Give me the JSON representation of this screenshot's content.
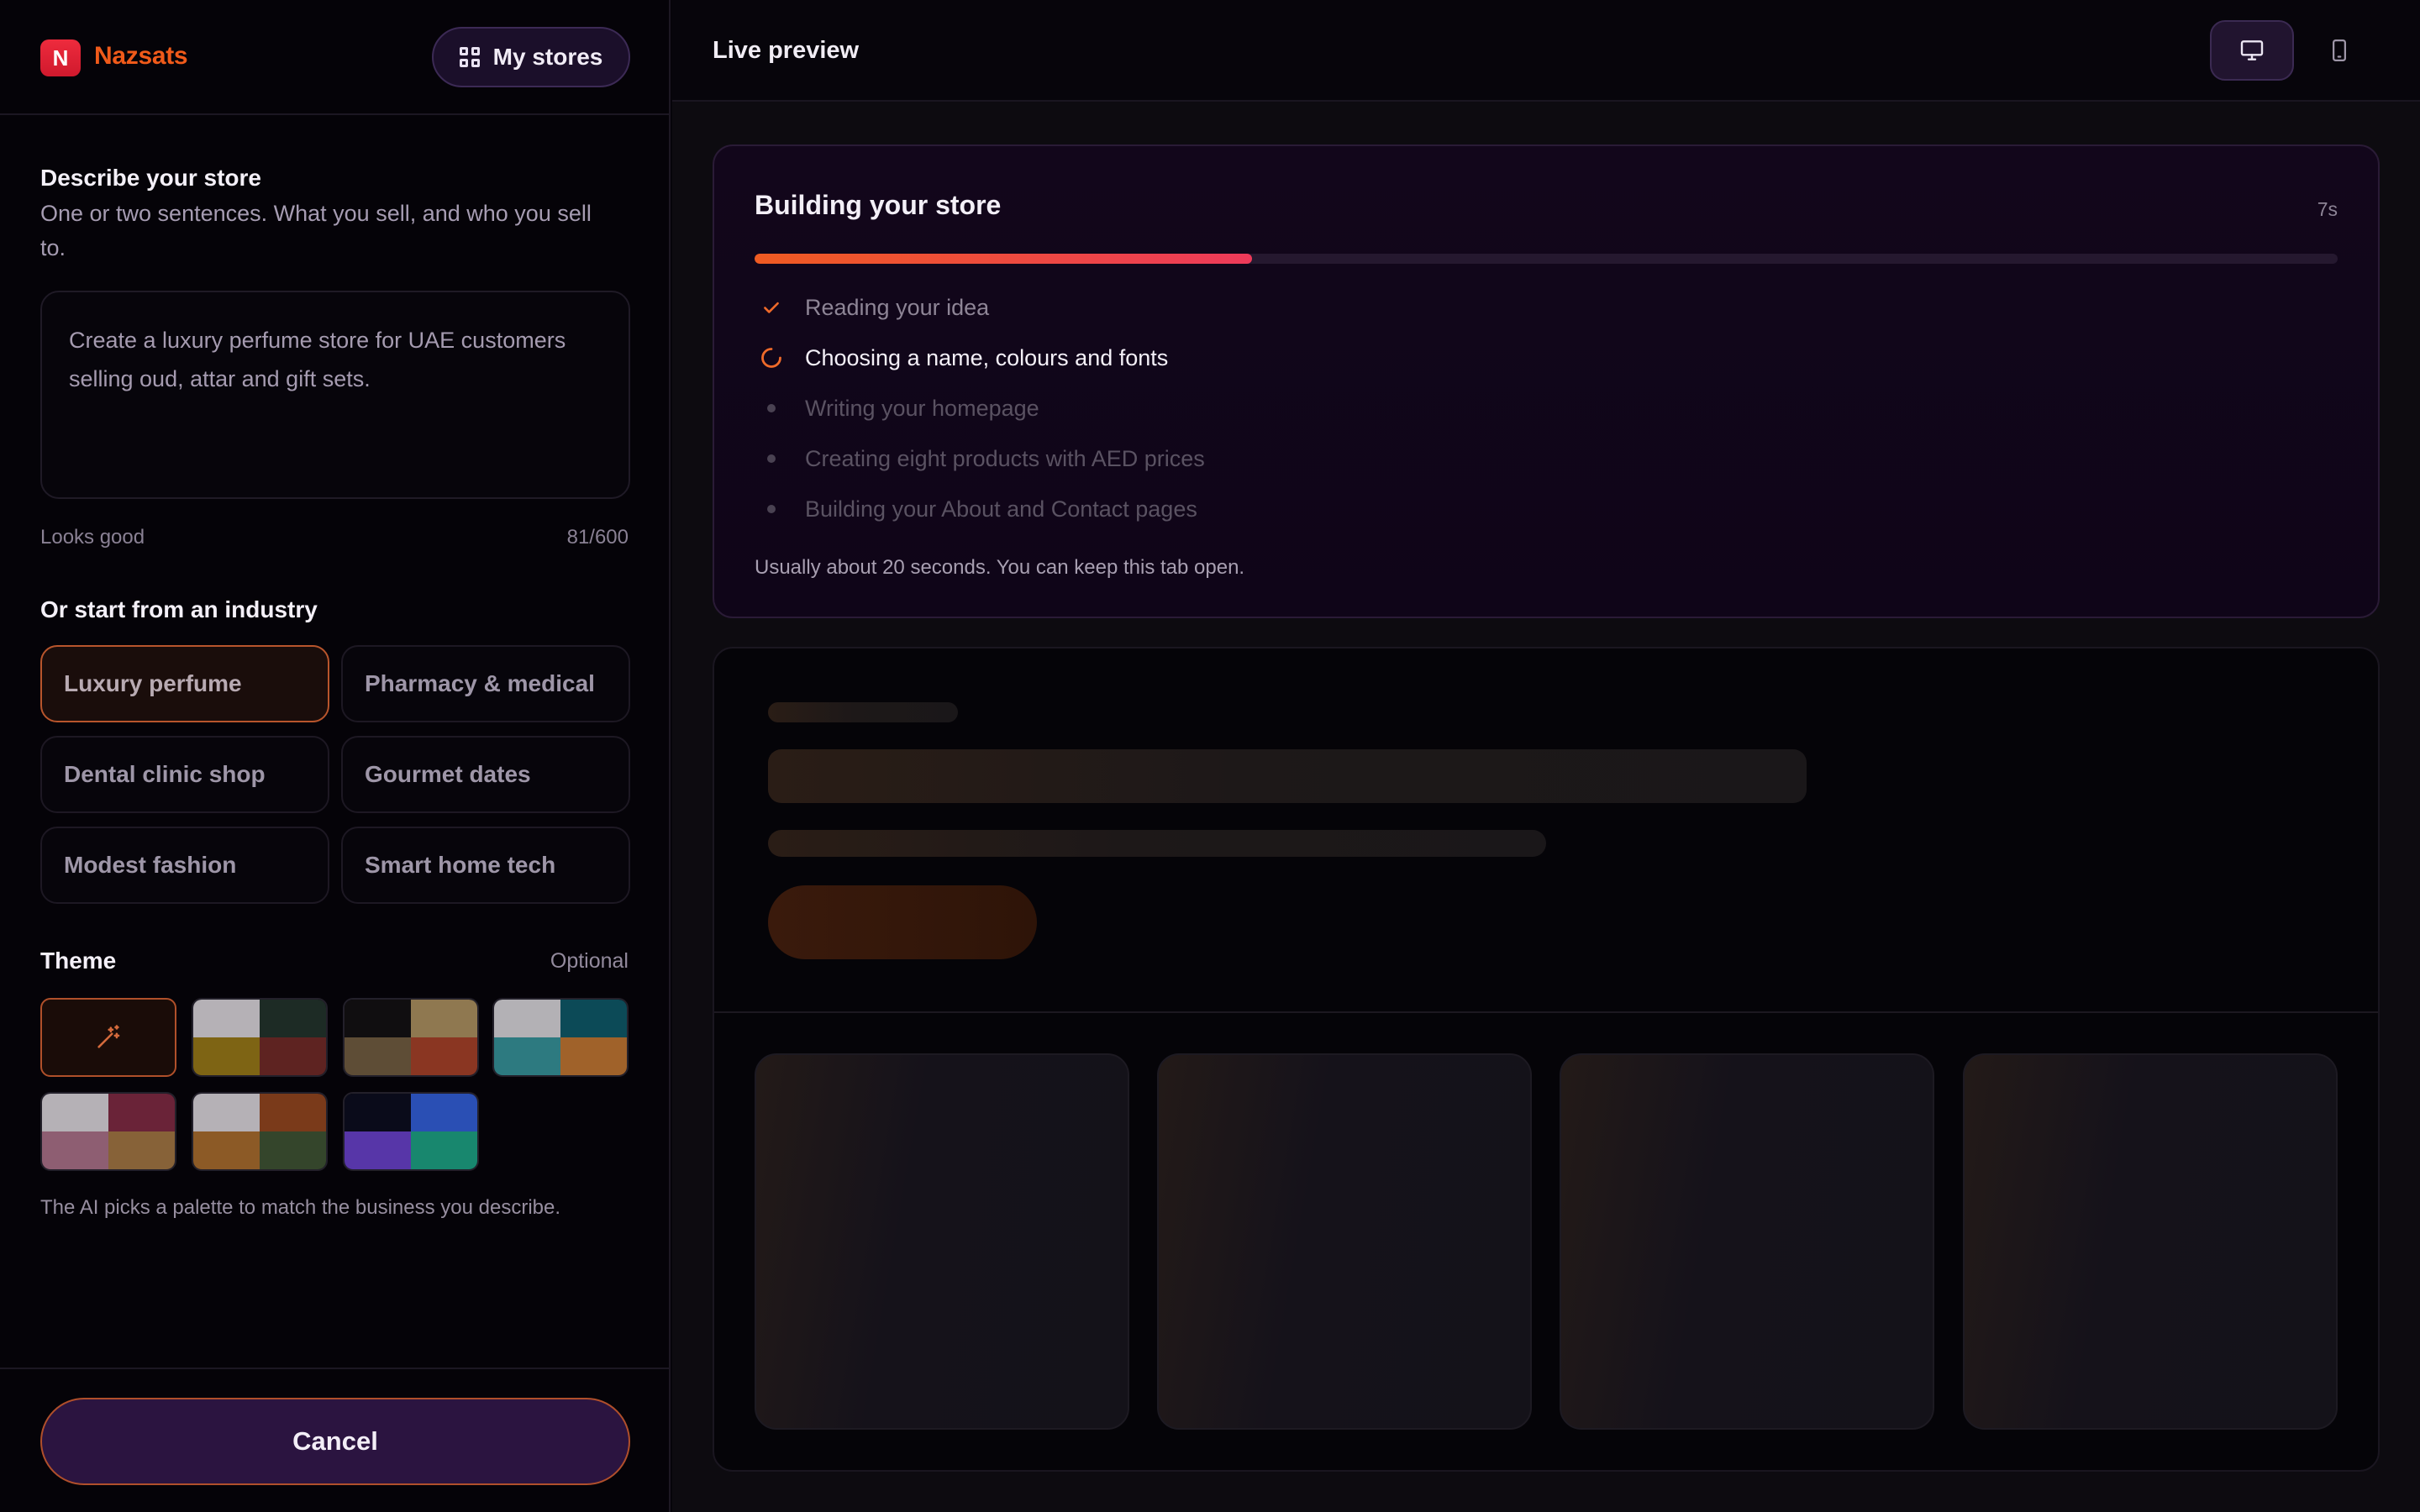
{
  "brand": {
    "logo_letter": "N",
    "name": "Nazsats"
  },
  "header": {
    "my_stores_label": "My stores"
  },
  "describe": {
    "title": "Describe your store",
    "subtitle": "One or two sentences. What you sell, and who you sell to.",
    "value": "Create a luxury perfume store for UAE customers selling oud, attar and gift sets.",
    "status": "Looks good",
    "counter": "81/600"
  },
  "industry": {
    "title": "Or start from an industry",
    "options": [
      "Luxury perfume",
      "Pharmacy & medical",
      "Dental clinic shop",
      "Gourmet dates",
      "Modest fashion",
      "Smart home tech"
    ],
    "selected": "Luxury perfume"
  },
  "theme": {
    "title": "Theme",
    "optional_label": "Optional",
    "auto_icon": "magic-wand-icon",
    "palettes": [
      [
        "#b5b1b6",
        "#1d2b25",
        "#7e6414",
        "#5e2321"
      ],
      [
        "#100e10",
        "#8f7850",
        "#5e4d36",
        "#8a3622"
      ],
      [
        "#b3b1b5",
        "#0c4a57",
        "#2d7a80",
        "#a0622a"
      ],
      [
        "#b5b1b6",
        "#6a2338",
        "#8e5e72",
        "#876238"
      ],
      [
        "#b5b1b6",
        "#7a3a1a",
        "#8c5a26",
        "#34452b"
      ],
      [
        "#0a0b1a",
        "#2a4fb4",
        "#5736a8",
        "#18876e"
      ]
    ],
    "note": "The AI picks a palette to match the business you describe."
  },
  "footer": {
    "cancel_label": "Cancel"
  },
  "preview": {
    "title": "Live preview",
    "devices": [
      {
        "icon": "desktop-icon",
        "active": true
      },
      {
        "icon": "mobile-icon",
        "active": false
      }
    ]
  },
  "build": {
    "title": "Building your store",
    "elapsed": "7s",
    "progress": 0.314,
    "steps": [
      {
        "label": "Reading your idea",
        "state": "done"
      },
      {
        "label": "Choosing a name, colours and fonts",
        "state": "active"
      },
      {
        "label": "Writing your homepage",
        "state": "pending"
      },
      {
        "label": "Creating eight products with AED prices",
        "state": "pending"
      },
      {
        "label": "Building your About and Contact pages",
        "state": "pending"
      }
    ],
    "note": "Usually about 20 seconds. You can keep this tab open."
  },
  "colors": {
    "accent": "#f05a1a",
    "logo": "#e11d2e",
    "progress_end": "#ee3a5a",
    "cta_bg": "#2b1440"
  }
}
